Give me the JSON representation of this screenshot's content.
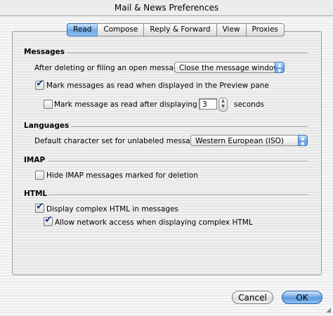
{
  "window": {
    "title": "Mail & News Preferences"
  },
  "tabs": [
    {
      "label": "Read",
      "active": true
    },
    {
      "label": "Compose",
      "active": false
    },
    {
      "label": "Reply & Forward",
      "active": false
    },
    {
      "label": "View",
      "active": false
    },
    {
      "label": "Proxies",
      "active": false
    }
  ],
  "messages": {
    "heading": "Messages",
    "after_delete_label": "After deleting or filing an open message:",
    "after_delete_value": "Close the message window",
    "mark_read_preview": {
      "label": "Mark messages as read when displayed in the Preview pane",
      "checked": true
    },
    "mark_read_after": {
      "label": "Mark message as read after displaying for",
      "checked": false,
      "value": "3",
      "unit": "seconds"
    }
  },
  "languages": {
    "heading": "Languages",
    "charset_label": "Default character set for unlabeled messages:",
    "charset_value": "Western European (ISO)"
  },
  "imap": {
    "heading": "IMAP",
    "hide_deleted": {
      "label": "Hide IMAP messages marked for deletion",
      "checked": false
    }
  },
  "html": {
    "heading": "HTML",
    "display_complex": {
      "label": "Display complex HTML in messages",
      "checked": true
    },
    "allow_network": {
      "label": "Allow network access when displaying complex HTML",
      "checked": true
    }
  },
  "buttons": {
    "cancel": "Cancel",
    "ok": "OK"
  },
  "colors": {
    "accent": "#6fa9e6",
    "check": "#1f3e8a"
  },
  "icons": {
    "checkmark": "checkmark-icon",
    "popup_arrows": "popup-arrows-icon",
    "stepper": "stepper-arrows-icon"
  }
}
